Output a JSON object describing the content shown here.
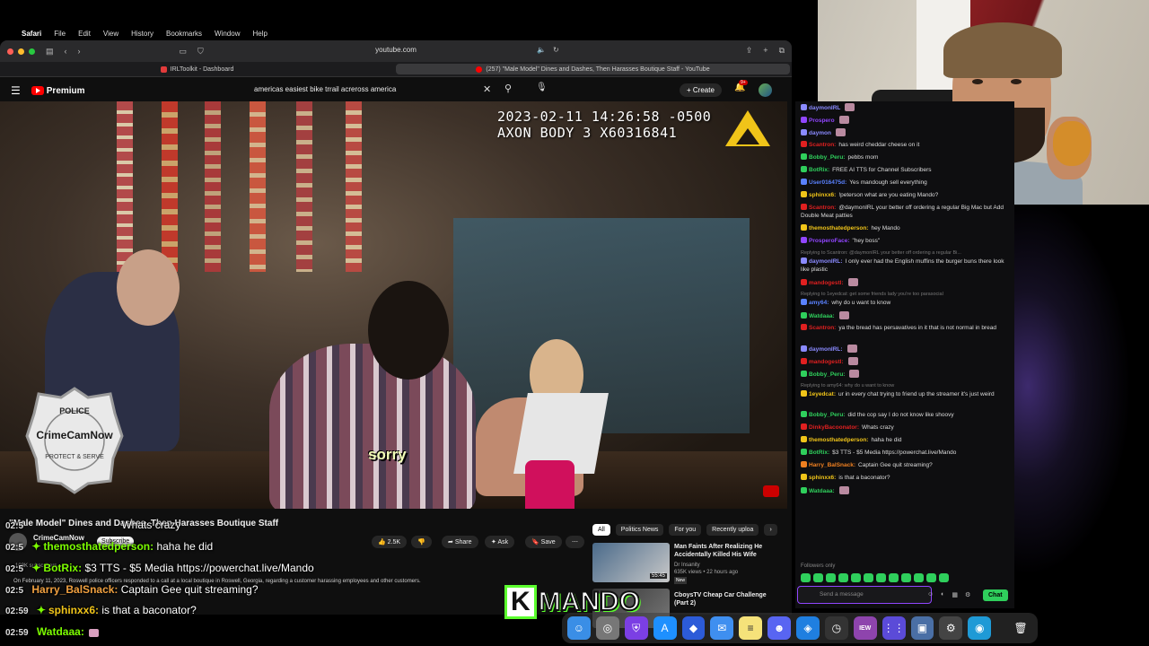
{
  "menubar": {
    "apple": "",
    "app": "Safari",
    "items": [
      "File",
      "Edit",
      "View",
      "History",
      "Bookmarks",
      "Window",
      "Help"
    ]
  },
  "safari": {
    "address": "youtube.com",
    "tabs": [
      {
        "label": "IRLToolkit - Dashboard",
        "active": false
      },
      {
        "label": "(257) \"Male Model\" Dines and Dashes, Then Harasses Boutique Staff - YouTube",
        "active": true
      }
    ]
  },
  "youtube": {
    "logo": "Premium",
    "search_value": "americas easiest bike trrail acreross america",
    "create_label": "Create",
    "notifications": "9+"
  },
  "video": {
    "timestamp": "2023-02-11 14:26:58 -0500",
    "camera": "AXON BODY 3 X60316841",
    "subtitle": "sorry",
    "badge_top": "POLICE",
    "badge_name": "CrimeCamNow",
    "badge_bottom": "PROTECT & SERVE"
  },
  "details": {
    "title": "\"Male Model\" Dines and Dashes, Then Harasses Boutique Staff",
    "channel": "CrimeCamNow",
    "subs": "103K subscribers",
    "subscribe": "Subscribe",
    "likes": "2.5K",
    "share": "Share",
    "ask": "Ask",
    "save": "Save",
    "description": "On February 11, 2023, Roswell police officers responded to a call at a local boutique in Roswell, Georgia, regarding a customer harassing employees and other customers."
  },
  "chips": [
    "All",
    "Politics News",
    "For you",
    "Recently uploa"
  ],
  "recommendations": [
    {
      "title": "Man Faints After Realizing He Accidentally Killed His Wife",
      "channel": "Dr Insanity",
      "meta": "635K views • 22 hours ago",
      "duration": "55:45",
      "badge": "New"
    },
    {
      "title": "CboysTV Cheap Car Challenge (Part 2)",
      "channel": "",
      "meta": "",
      "duration": "",
      "badge": ""
    }
  ],
  "overlay_chat": [
    {
      "time": "02:5",
      "user": "",
      "msg": "Whats crazy"
    },
    {
      "time": "02:5",
      "user": "themosthatedperson:",
      "msg": "haha he did"
    },
    {
      "time": "02:5",
      "user": "BotRix:",
      "msg": "$3 TTS - $5 Media https://powerchat.live/Mando"
    },
    {
      "time": "02:5",
      "user": "Harry_BalSnack:",
      "msg": "Captain Gee quit streaming?"
    },
    {
      "time": "02:59",
      "user": "sphinxx6:",
      "msg": "is that a baconator?"
    },
    {
      "time": "02:59",
      "user": "Watdaaa:",
      "msg": ""
    }
  ],
  "chat": {
    "messages": [
      {
        "user": "daymonIRL",
        "color": "#8a8aff",
        "text": ""
      },
      {
        "user": "Prospero",
        "color": "#9146ff",
        "text": ""
      },
      {
        "user": "daymon",
        "color": "#8a8aff",
        "text": ""
      },
      {
        "user": "Scantron:",
        "color": "#e02020",
        "text": "has weird cheddar cheese on it"
      },
      {
        "user": "Bobby_Peru:",
        "color": "#2fcf5c",
        "text": "pebbs mom"
      },
      {
        "user": "BotRix:",
        "color": "#2fcf5c",
        "text": "FREE AI TTS for Channel Subscribers"
      },
      {
        "user": "User016475d:",
        "color": "#5a82ff",
        "text": "Yes mandough sell everything"
      },
      {
        "user": "sphinxx6:",
        "color": "#f0c419",
        "text": "!peterson what are you eating Mando?"
      },
      {
        "user": "Scantron:",
        "color": "#e02020",
        "text": "@daymonIRL your better off ordering a regular Big Mac but Add Double Meat patties"
      },
      {
        "user": "themosthatedperson:",
        "color": "#f0c419",
        "text": "hey Mando"
      },
      {
        "user": "ProsperoFace:",
        "color": "#9146ff",
        "text": "\"hey boss\""
      },
      {
        "reply": "Replying to Scantron: @daymonIRL your better off ordering a regular Bi...",
        "user": "daymonIRL:",
        "color": "#8a8aff",
        "text": "I only ever had the English muffins the burger buns there look like plastic"
      },
      {
        "user": "mandogestl:",
        "color": "#e02020",
        "text": ""
      },
      {
        "reply": "Replying to 1eyedcat: get some friends lady you're too parasocial",
        "user": "amy64:",
        "color": "#5a82ff",
        "text": "why do u want to know"
      },
      {
        "user": "Watdaaa:",
        "color": "#2fcf5c",
        "text": ""
      },
      {
        "user": "Scantron:",
        "color": "#e02020",
        "text": "ya the bread has persavatives in it that is not normal in bread"
      },
      {
        "user": "daymonIRL:",
        "color": "#8a8aff",
        "text": ""
      },
      {
        "user": "mandogestl:",
        "color": "#e02020",
        "text": ""
      },
      {
        "user": "Bobby_Peru:",
        "color": "#2fcf5c",
        "text": ""
      },
      {
        "reply": "Replying to amy64: why do u want to know",
        "user": "1eyedcat:",
        "color": "#f0c419",
        "text": "ur in every chat trying to friend up the streamer it's just weird"
      },
      {
        "user": "Bobby_Peru:",
        "color": "#2fcf5c",
        "text": "did the cop say I do not know like shoovy"
      },
      {
        "user": "DinkyBacoonator:",
        "color": "#e02020",
        "text": "Whats crazy"
      },
      {
        "user": "themosthatedperson:",
        "color": "#f0c419",
        "text": "haha he did"
      },
      {
        "user": "BotRix:",
        "color": "#2fcf5c",
        "text": "$3 TTS - $5 Media https://powerchat.live/Mando"
      },
      {
        "user": "Harry_BalSnack:",
        "color": "#f08020",
        "text": "Captain Gee quit streaming?"
      },
      {
        "user": "sphinxx6:",
        "color": "#f0c419",
        "text": "is that a baconator?"
      },
      {
        "user": "Watdaaa:",
        "color": "#2fcf5c",
        "text": ""
      }
    ],
    "followers_only": "Followers only",
    "input_placeholder": "Send a message",
    "chat_button": "Chat"
  },
  "branding": {
    "k": "K",
    "rest": "MANDO"
  },
  "dock": [
    "finder-icon",
    "launchpad-icon",
    "vpn-icon",
    "appstore-icon",
    "browser-icon",
    "mail-icon",
    "notes-icon",
    "discord-icon",
    "safari-icon",
    "activity-icon",
    "iew-icon",
    "grid-icon",
    "finder2-icon",
    "settings-icon",
    "system-icon",
    "trash-icon"
  ]
}
